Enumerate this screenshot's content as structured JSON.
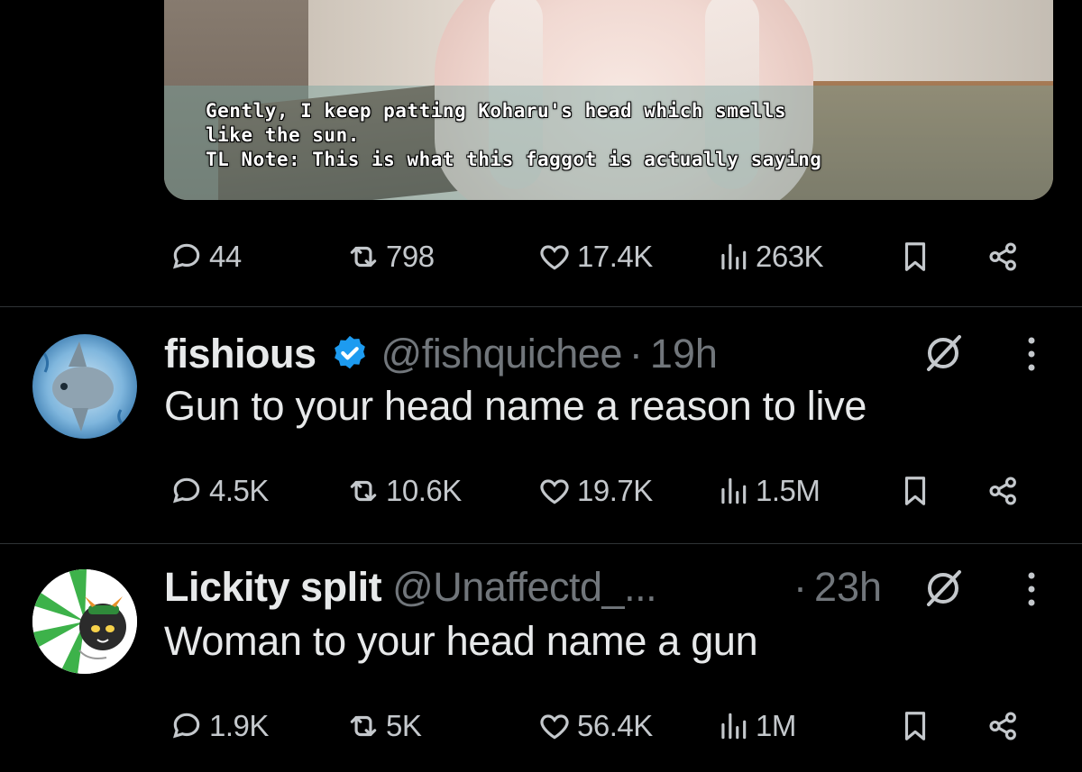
{
  "media": {
    "subtitle_lines": [
      "Gently, I keep patting Koharu's head which smells",
      "like the sun.",
      "TL Note: This is what this faggot is actually saying"
    ]
  },
  "tweets": [
    {
      "metrics": {
        "replies": "44",
        "reposts": "798",
        "likes": "17.4K",
        "views": "263K"
      }
    },
    {
      "display_name": "fishious",
      "verified": true,
      "handle": "@fishquichee",
      "separator": "·",
      "time": "19h",
      "text": "Gun to your head name a reason to live",
      "metrics": {
        "replies": "4.5K",
        "reposts": "10.6K",
        "likes": "19.7K",
        "views": "1.5M"
      }
    },
    {
      "display_name": "Lickity split",
      "verified": false,
      "handle": "@Unaffectd_...",
      "separator": "·",
      "time": "23h",
      "text": "Woman to your head name a gun",
      "metrics": {
        "replies": "1.9K",
        "reposts": "5K",
        "likes": "56.4K",
        "views": "1M"
      }
    }
  ],
  "icons": {
    "reply": "reply-icon",
    "repost": "repost-icon",
    "like": "heart-icon",
    "views": "views-chart-icon",
    "bookmark": "bookmark-icon",
    "share": "share-icon",
    "grok": "grok-icon",
    "more": "more-vertical-icon",
    "verified": "verified-badge-icon"
  },
  "colors": {
    "background": "#000000",
    "text": "#e7e9ea",
    "muted": "#71767b",
    "icon": "#c4c8cc",
    "verified": "#1d9bf0"
  }
}
